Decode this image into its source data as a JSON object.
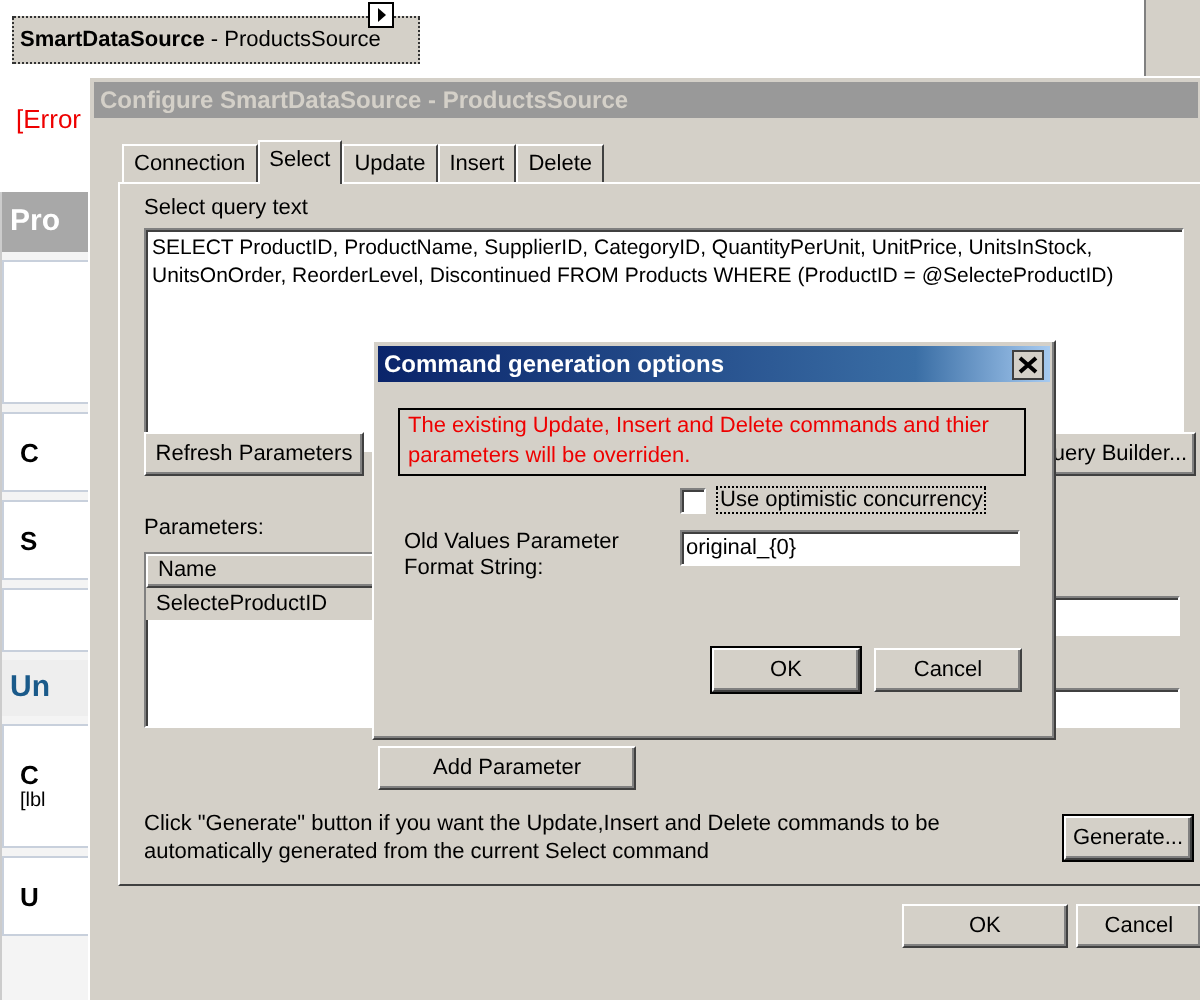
{
  "designer": {
    "component": {
      "name": "SmartDataSource",
      "suffix": " - ProductsSource"
    },
    "error_text": "[Error",
    "header_1": "Pro",
    "header_2": "Un",
    "label_fragment": "[lbl",
    "item_letters": [
      "C",
      "S",
      "C",
      "U"
    ]
  },
  "dialog": {
    "title": "Configure SmartDataSource - ProductsSource",
    "tabs": [
      {
        "label": "Connection",
        "selected": false
      },
      {
        "label": "Select",
        "selected": true
      },
      {
        "label": "Update",
        "selected": false
      },
      {
        "label": "Insert",
        "selected": false
      },
      {
        "label": "Delete",
        "selected": false
      }
    ],
    "query_label": "Select query text",
    "query_text": "SELECT ProductID, ProductName, SupplierID, CategoryID, QuantityPerUnit, UnitPrice, UnitsInStock, UnitsOnOrder, ReorderLevel, Discontinued FROM Products WHERE (ProductID = @SelecteProductID)",
    "refresh_button": "Refresh Parameters",
    "query_builder_button": "uery Builder...",
    "parameters_label": "Parameters:",
    "parameters": {
      "column": "Name",
      "rows": [
        {
          "name": "SelecteProductID",
          "selected": true
        }
      ]
    },
    "add_parameter_button": "Add Parameter",
    "hint": "Click \"Generate\" button if you want the Update,Insert and Delete commands to be automatically generated from the current Select command",
    "generate_button": "Generate...",
    "ok_button": "OK",
    "cancel_button": "Cancel"
  },
  "modal": {
    "title": "Command generation options",
    "warning": "The existing Update, Insert and Delete commands and thier parameters will be overriden.",
    "optimistic": {
      "label": "Use optimistic concurrency",
      "checked": false
    },
    "format_label": "Old Values Parameter Format String:",
    "format_value": "original_{0}",
    "ok_button": "OK",
    "cancel_button": "Cancel"
  }
}
